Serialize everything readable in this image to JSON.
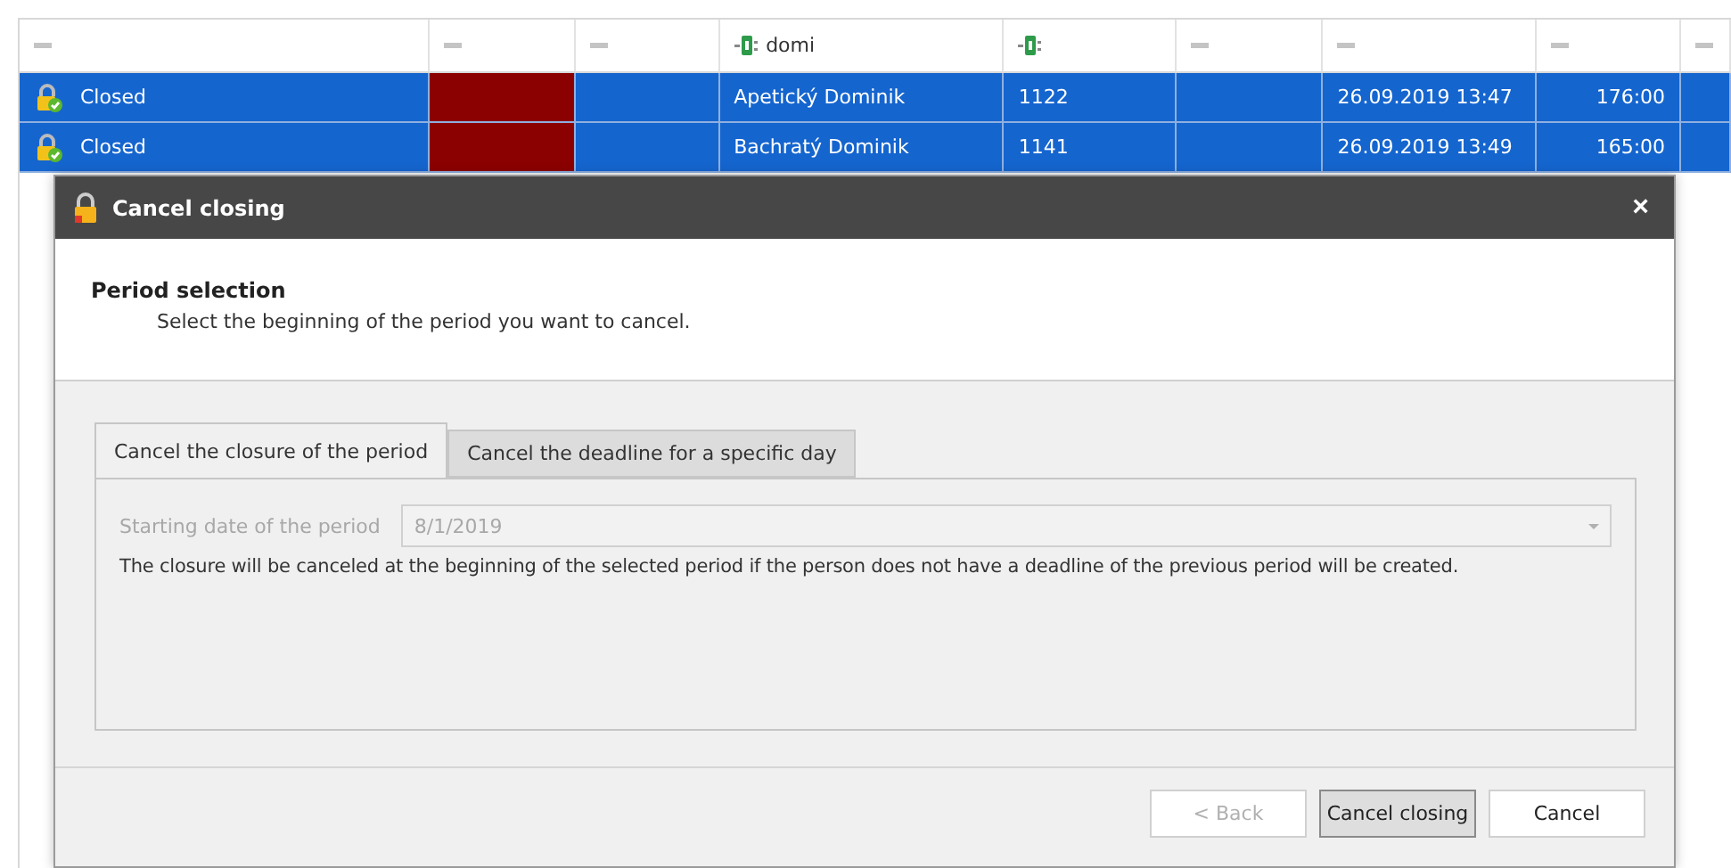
{
  "grid": {
    "columns": [
      {
        "kind": "filter"
      },
      {
        "kind": "filter"
      },
      {
        "kind": "filter"
      },
      {
        "kind": "search",
        "text": "domi"
      },
      {
        "kind": "search"
      },
      {
        "kind": "filter"
      },
      {
        "kind": "filter"
      },
      {
        "kind": "filter"
      },
      {
        "kind": "filter"
      }
    ],
    "rows": [
      {
        "selected": true,
        "status": "Closed",
        "color": "#8b0000",
        "name": "Apetický Dominik",
        "number": "1122",
        "date": "26.09.2019 13:47",
        "hours": "176:00"
      },
      {
        "selected": true,
        "status": "Closed",
        "color": "#8b0000",
        "name": "Bachratý Dominik",
        "number": "1141",
        "date": "26.09.2019 13:49",
        "hours": "165:00"
      }
    ]
  },
  "dialog": {
    "title": "Cancel closing",
    "close": "×",
    "heading": "Period selection",
    "subtitle": "Select the beginning of the period you want to cancel.",
    "tabs": [
      {
        "label": "Cancel the closure of the period",
        "selected": true
      },
      {
        "label": "Cancel the deadline for a specific day",
        "selected": false
      }
    ],
    "field": {
      "label": "Starting date of the period",
      "value": "8/1/2019",
      "disabled": true
    },
    "note": "The closure will be canceled at the beginning of the selected period if the person does not have a deadline of the previous period will be created.",
    "buttons": [
      {
        "label": "< Back",
        "disabled": true,
        "focused": false
      },
      {
        "label": "Cancel closing",
        "disabled": false,
        "focused": true
      },
      {
        "label": "Cancel",
        "disabled": false,
        "focused": false
      }
    ]
  }
}
